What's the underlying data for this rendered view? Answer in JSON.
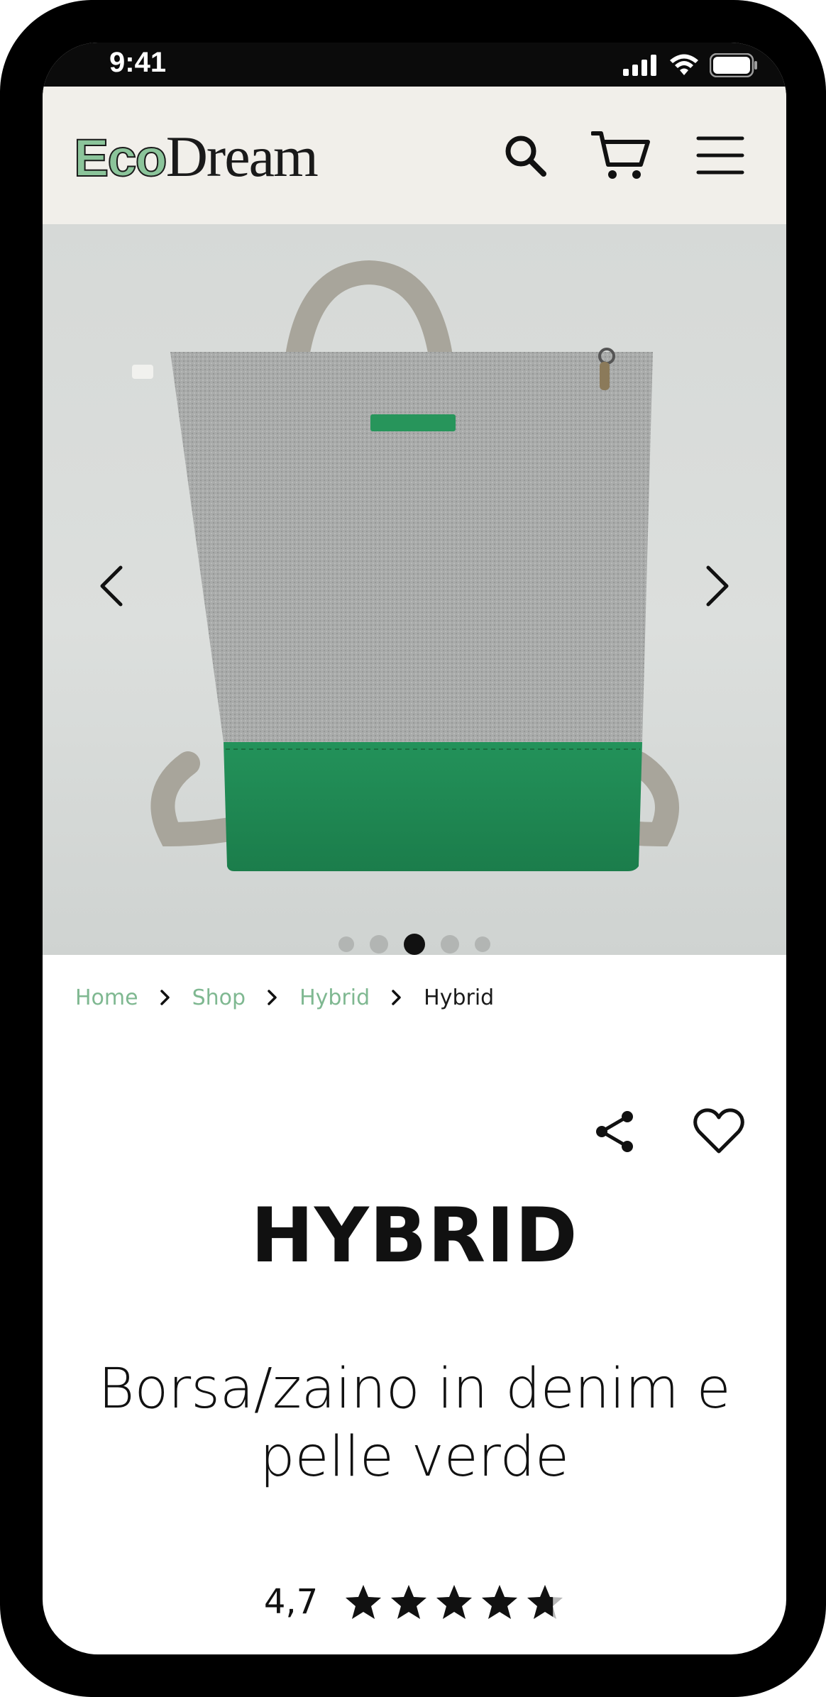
{
  "status_bar": {
    "time": "9:41"
  },
  "header": {
    "logo_part1": "Eco",
    "logo_part2": "Dream",
    "icons": [
      "search-icon",
      "cart-icon",
      "menu-icon"
    ]
  },
  "gallery": {
    "slide_count": 5,
    "active_index": 2
  },
  "breadcrumb": {
    "items": [
      "Home",
      "Shop",
      "Hybrid"
    ],
    "current": "Hybrid"
  },
  "product": {
    "name": "HYBRID",
    "description": "Borsa/zaino in denim e pelle verde",
    "rating_label": "4,7",
    "rating_value": 4.7,
    "rating_max": 5
  },
  "colors": {
    "brand_green": "#7fb891",
    "header_bg": "#f1efea",
    "text": "#111111"
  }
}
